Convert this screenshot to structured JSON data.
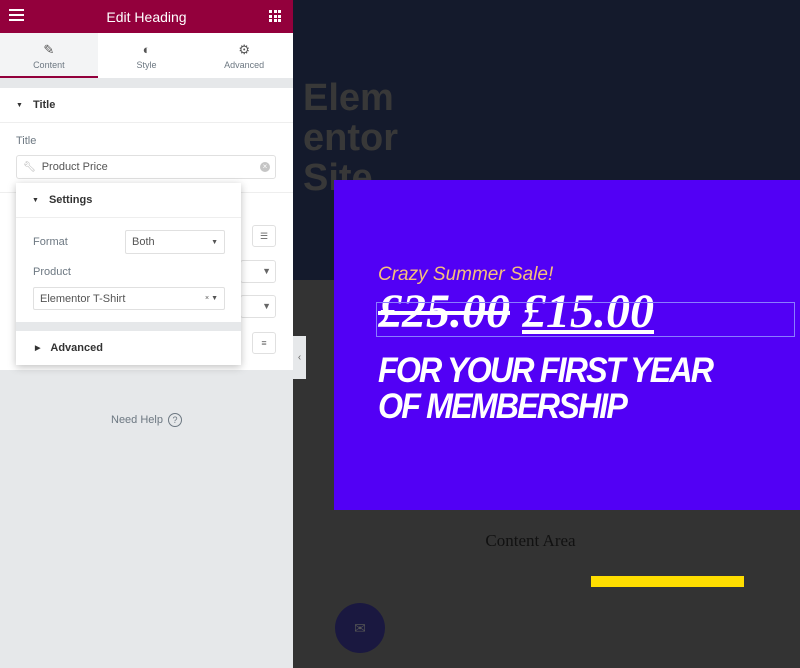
{
  "header": {
    "title": "Edit Heading",
    "menu_icon": "hamburger-icon",
    "apps_icon": "grid-icon"
  },
  "tabs": [
    {
      "label": "Content",
      "icon": "pencil-icon",
      "active": true
    },
    {
      "label": "Style",
      "icon": "half-circle-icon"
    },
    {
      "label": "Advanced",
      "icon": "gear-icon"
    }
  ],
  "section": {
    "title": "Title"
  },
  "title_field": {
    "label": "Title",
    "value": "Product Price"
  },
  "popover": {
    "settings_label": "Settings",
    "format_label": "Format",
    "format_value": "Both",
    "product_label": "Product",
    "product_value": "Elementor T-Shirt",
    "advanced_label": "Advanced"
  },
  "help": {
    "label": "Need Help",
    "icon": "?"
  },
  "canvas": {
    "site_title_lines": [
      "Elem",
      "entor",
      "Site"
    ],
    "promo_kicker": "Crazy Summer Sale!",
    "price_old": "£25.00",
    "price_new": "£15.00",
    "tagline_lines": [
      "FOR YOUR FIRST YEAR",
      "OF MEMBERSHIP"
    ],
    "content_area": "Content Area",
    "promo_color": "#5200f5",
    "accent": "#93003c",
    "bar_color": "#ffde00"
  }
}
